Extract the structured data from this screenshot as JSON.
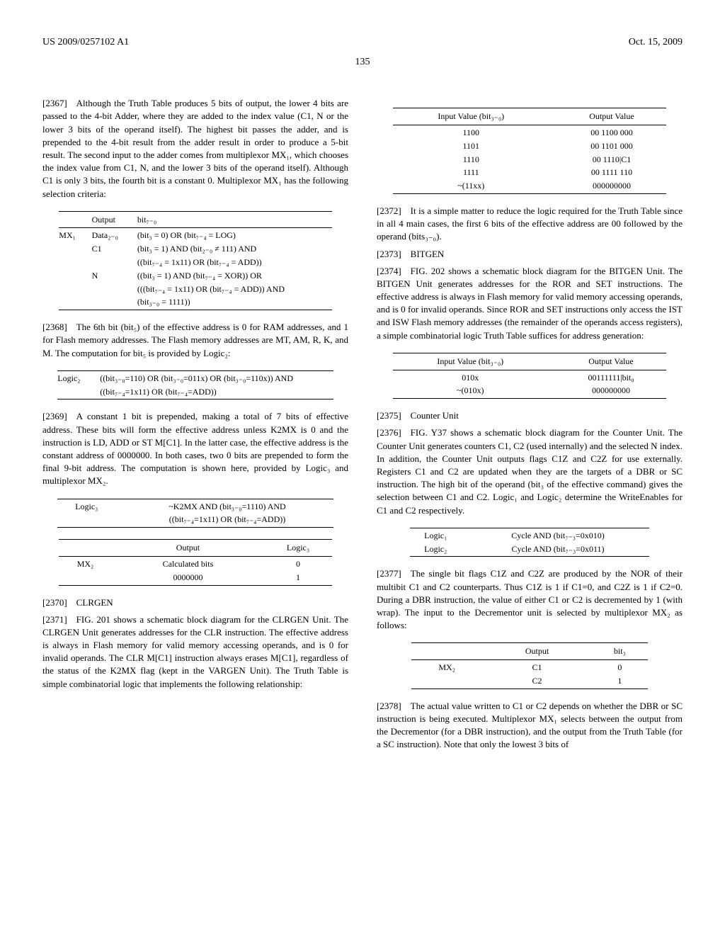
{
  "header": {
    "pub_number": "US 2009/0257102 A1",
    "date": "Oct. 15, 2009",
    "page": "135"
  },
  "left_column": {
    "p2367": "[2367] Although the Truth Table produces 5 bits of output, the lower 4 bits are passed to the 4-bit Adder, where they are added to the index value (C1, N or the lower 3 bits of the operand itself). The highest bit passes the adder, and is prepended to the 4-bit result from the adder result in order to produce a 5-bit result. The second input to the adder comes from multiplexor MX₁, which chooses the index value from C1, N, and the lower 3 bits of the operand itself). Although C1 is only 3 bits, the fourth bit is a constant 0. Multiplexor MX₁ has the following selection criteria:",
    "table_mx1": {
      "headers": [
        "",
        "Output",
        "bit₇₋₀"
      ],
      "rows": [
        [
          "MX₁",
          "Data₂₋₀",
          "(bit₃ = 0) OR (bit₇₋₄ = LOG)"
        ],
        [
          "",
          "C1",
          "(bit₃ = 1) AND (bit₂₋₀ ≠ 111) AND"
        ],
        [
          "",
          "",
          "((bit₇₋₄ = 1x11) OR (bit₇₋₄ = ADD))"
        ],
        [
          "",
          "N",
          "((bit₃ = 1) AND (bit₇₋₄ = XOR)) OR"
        ],
        [
          "",
          "",
          "(((bit₇₋₄ = 1x11) OR (bit₇₋₄ = ADD)) AND"
        ],
        [
          "",
          "",
          "(bit₃₋₀ = 1111))"
        ]
      ]
    },
    "p2368": "[2368] The 6th bit (bit₅) of the effective address is 0 for RAM addresses, and 1 for Flash memory addresses. The Flash memory addresses are MT, AM, R, K, and M. The computation for bit₅ is provided by Logic₂:",
    "table_logic2": {
      "rows": [
        [
          "Logic₂",
          "((bit₃₋₀=110) OR (bit₃₋₀=011x) OR (bit₃₋₀=110x)) AND"
        ],
        [
          "",
          "((bit₇₋₄=1x11) OR (bit₇₋₄=ADD))"
        ]
      ]
    },
    "p2369": "[2369] A constant 1 bit is prepended, making a total of 7 bits of effective address. These bits will form the effective address unless K2MX is 0 and the instruction is LD, ADD or ST M[C1]. In the latter case, the effective address is the constant address of 0000000. In both cases, two 0 bits are prepended to form the final 9-bit address. The computation is shown here, provided by Logic₃ and multiplexor MX₂.",
    "table_logic3": {
      "rows": [
        [
          "Logic₃",
          "~K2MX AND (bit₃₋₀=1110) AND"
        ],
        [
          "",
          "((bit₇₋₄=1x11) OR (bit₇₋₄=ADD))"
        ]
      ]
    },
    "table_mx2": {
      "headers": [
        "",
        "Output",
        "Logic₃"
      ],
      "rows": [
        [
          "MX₂",
          "Calculated bits",
          "0"
        ],
        [
          "",
          "0000000",
          "1"
        ]
      ]
    },
    "p2370": "[2370] CLRGEN",
    "p2371": "[2371] FIG. 201 shows a schematic block diagram for the CLRGEN Unit. The CLRGEN Unit generates addresses for the CLR instruction. The effective address is always in Flash memory for valid memory accessing operands, and is 0 for invalid operands. The CLR M[C1] instruction always erases M[C1], regardless of the status of the K2MX flag (kept in the VARGEN Unit). The Truth Table is simple combinatorial logic that implements the following relationship:"
  },
  "right_column": {
    "table_input_output": {
      "headers": [
        "Input Value (bit₃₋₀)",
        "Output Value"
      ],
      "rows": [
        [
          "1100",
          "00 1100 000"
        ],
        [
          "1101",
          "00 1101 000"
        ],
        [
          "1110",
          "00 1110|C1"
        ],
        [
          "1111",
          "00 1111 110"
        ],
        [
          "~(11xx)",
          "000000000"
        ]
      ]
    },
    "p2372": "[2372] It is a simple matter to reduce the logic required for the Truth Table since in all 4 main cases, the first 6 bits of the effective address are 00 followed by the operand (bits₃₋₀).",
    "p2373": "[2373] BITGEN",
    "p2374": "[2374] FIG. 202 shows a schematic block diagram for the BITGEN Unit. The BITGEN Unit generates addresses for the ROR and SET instructions. The effective address is always in Flash memory for valid memory accessing operands, and is 0 for invalid operands. Since ROR and SET instructions only access the IST and ISW Flash memory addresses (the remainder of the operands access registers), a simple combinatorial logic Truth Table suffices for address generation:",
    "table_bitgen": {
      "headers": [
        "Input Value (bit₃₋₀)",
        "Output Value"
      ],
      "rows": [
        [
          "010x",
          "00111111|bit₀"
        ],
        [
          "~(010x)",
          "000000000"
        ]
      ]
    },
    "p2375": "[2375] Counter Unit",
    "p2376": "[2376] FIG. Y37 shows a schematic block diagram for the Counter Unit. The Counter Unit generates counters C1, C2 (used internally) and the selected N index. In addition, the Counter Unit outputs flags C1Z and C2Z for use externally. Registers C1 and C2 are updated when they are the targets of a DBR or SC instruction. The high bit of the operand (bit₃ of the effective command) gives the selection between C1 and C2. Logic₁ and Logic₂ determine the WriteEnables for C1 and C2 respectively.",
    "table_logic12": {
      "rows": [
        [
          "Logic₁",
          "Cycle AND (bit₇₋₃=0x010)"
        ],
        [
          "Logic₂",
          "Cycle AND (bit₇₋₃=0x011)"
        ]
      ]
    },
    "p2377": "[2377] The single bit flags C1Z and C2Z are produced by the NOR of their multibit C1 and C2 counterparts. Thus C1Z is 1 if C1=0, and C2Z is 1 if C2=0. During a DBR instruction, the value of either C1 or C2 is decremented by 1 (with wrap). The input to the Decrementor unit is selected by multiplexor MX₂ as follows:",
    "table_mx2r": {
      "headers": [
        "",
        "Output",
        "bit₃"
      ],
      "rows": [
        [
          "MX₂",
          "C1",
          "0"
        ],
        [
          "",
          "C2",
          "1"
        ]
      ]
    },
    "p2378": "[2378] The actual value written to C1 or C2 depends on whether the DBR or SC instruction is being executed. Multiplexor MX₁ selects between the output from the Decrementor (for a DBR instruction), and the output from the Truth Table (for a SC instruction). Note that only the lowest 3 bits of"
  }
}
